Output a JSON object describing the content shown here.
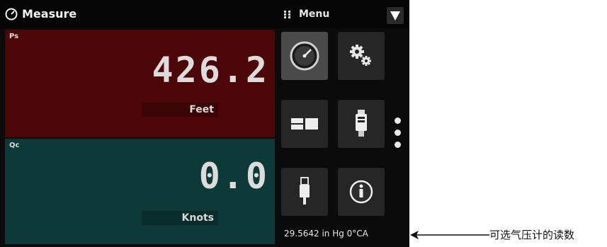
{
  "titlebar": {
    "title": "Measure",
    "menu_label": "Menu",
    "icons": [
      "gauge-icon",
      "grid-dots-icon",
      "chevron-down-icon"
    ]
  },
  "channels": [
    {
      "name": "Ps",
      "value": "426.2",
      "unit": "Feet",
      "color": "#4d0607"
    },
    {
      "name": "Qc",
      "value": "0.0",
      "unit": "Knots",
      "color": "#0d3a38"
    }
  ],
  "menu": {
    "items": [
      {
        "icon": "gauge-icon",
        "selected": true
      },
      {
        "icon": "gears-icon",
        "selected": false
      },
      {
        "icon": "display-icon",
        "selected": false
      },
      {
        "icon": "sensor-module-icon",
        "selected": false
      },
      {
        "icon": "usb-icon",
        "selected": false
      },
      {
        "icon": "info-icon",
        "selected": false
      }
    ],
    "page_dots": 3
  },
  "status": {
    "barometer_reading": "29.5642 in Hg 0°CA"
  },
  "annotation": {
    "text": "可选气压计的读数"
  }
}
